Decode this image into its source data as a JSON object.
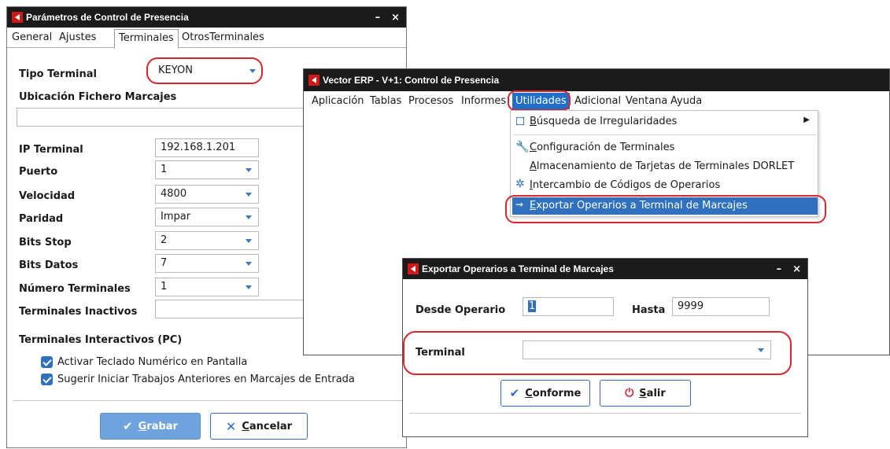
{
  "params_window": {
    "title": "Parámetros de Control de Presencia",
    "controls": {
      "minimize": "–",
      "close": "×"
    },
    "tabs": [
      "General",
      "Ajustes",
      "Terminales",
      "OtrosTerminales"
    ],
    "tipo_terminal": {
      "label": "Tipo Terminal",
      "value": "KEYON"
    },
    "ubicacion_label": "Ubicación Fichero Marcajes",
    "ubicacion_value": "",
    "ip": {
      "label": "IP Terminal",
      "value": "192.168.1.201"
    },
    "puerto": {
      "label": "Puerto",
      "value": "1"
    },
    "velocidad": {
      "label": "Velocidad",
      "value": "4800"
    },
    "paridad": {
      "label": "Paridad",
      "value": "Impar"
    },
    "bits_stop": {
      "label": "Bits Stop",
      "value": "2"
    },
    "bits_datos": {
      "label": "Bits Datos",
      "value": "7"
    },
    "numero_terminales": {
      "label": "Número Terminales",
      "value": "1"
    },
    "terminales_inactivos": {
      "label": "Terminales Inactivos",
      "value": ""
    },
    "interactivos_label": "Terminales Interactivos (PC)",
    "check1": "Activar Teclado Numérico en Pantalla",
    "check2": "Sugerir Iniciar Trabajos Anteriores en Marcajes de Entrada",
    "grabar_first": "G",
    "grabar_rest": "rabar",
    "cancelar_first": "C",
    "cancelar_rest": "ancelar"
  },
  "erp_window": {
    "title": "Vector ERP - V+1: Control de Presencia",
    "menu": [
      "Aplicación",
      "Tablas",
      "Procesos",
      "Informes",
      "Utilidades",
      "Adicional",
      "Ventana",
      "Ayuda"
    ],
    "dropdown": {
      "item1_first": "B",
      "item1_rest": "úsqueda de Irregularidades",
      "item2_first": "C",
      "item2_rest": "onfiguración de Terminales",
      "item3_first": "A",
      "item3_rest": "lmacenamiento de Tarjetas de Terminales DORLET",
      "item4_first": "I",
      "item4_rest": "ntercambio de Códigos de Operarios",
      "item5_first": "E",
      "item5_rest": "xportar Operarios a Terminal de Marcajes"
    }
  },
  "export_window": {
    "title": "Exportar Operarios a Terminal de Marcajes",
    "controls": {
      "minimize": "–",
      "close": "×"
    },
    "desde_label": "Desde Operario",
    "desde_value": "1",
    "hasta_label": "Hasta",
    "hasta_value": "9999",
    "terminal_label": "Terminal",
    "terminal_value": "",
    "conforme_first": "C",
    "conforme_rest": "onforme",
    "salir_first": "S",
    "salir_rest": "alir"
  },
  "colors": {
    "accent": "#2f70bf",
    "highlight": "#d8262f",
    "titlebar": "#1b1b1b",
    "menu_selected": "#1f6fc9"
  }
}
